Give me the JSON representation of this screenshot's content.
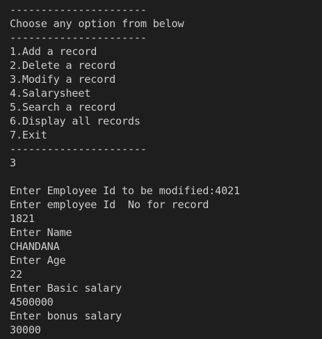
{
  "terminal": {
    "lines": [
      "----------------------",
      "Choose any option from below",
      "----------------------",
      "1.Add a record",
      "2.Delete a record",
      "3.Modify a record",
      "4.Salarysheet",
      "5.Search a record",
      "6.Display all records",
      "7.Exit",
      "----------------------",
      "3",
      "",
      "Enter Employee Id to be modified:4021",
      "Enter employee Id  No for record",
      "1821",
      "Enter Name",
      "CHANDANA",
      "Enter Age",
      "22",
      "Enter Basic salary",
      "4500000",
      "Enter bonus salary",
      "30000"
    ]
  }
}
